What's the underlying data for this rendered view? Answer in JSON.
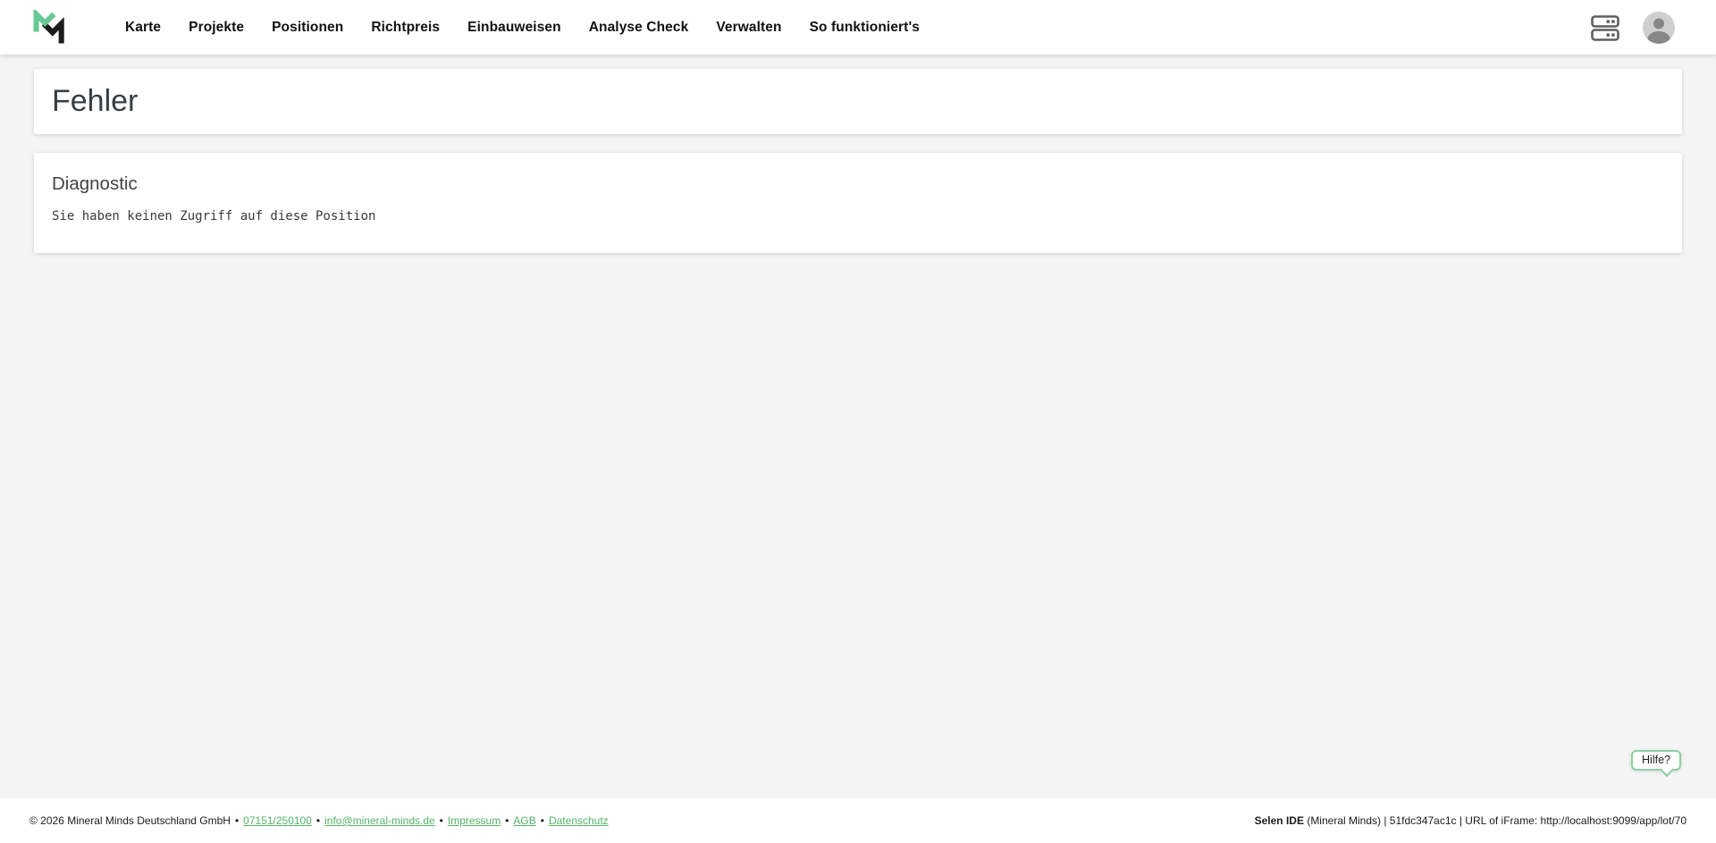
{
  "nav": {
    "items": [
      "Karte",
      "Projekte",
      "Positionen",
      "Richtpreis",
      "Einbauweisen",
      "Analyse Check",
      "Verwalten",
      "So funktioniert's"
    ],
    "icons": {
      "logo": "mineral-minds-logo",
      "storage": "storage-icon",
      "account": "account-avatar-icon"
    }
  },
  "page": {
    "title": "Fehler"
  },
  "diagnostic": {
    "heading": "Diagnostic",
    "message": "Sie haben keinen Zugriff auf diese Position"
  },
  "help": {
    "label": "Hilfe?"
  },
  "footer": {
    "copyright": "© 2026 Mineral Minds Deutschland GmbH",
    "separator": "•",
    "phone": "07151/250100",
    "email": "info@mineral-minds.de",
    "impressum": "Impressum",
    "agb": "AGB",
    "datenschutz": "Datenschutz",
    "app_name": "Selen IDE",
    "app_details": " (Mineral Minds) | 51fdc347ac1c | URL of iFrame: http://localhost:9099/app/lot/70"
  },
  "colors": {
    "brand_green": "#67C795",
    "link_green": "#55B169",
    "bubble_border_green": "#8BCFA4",
    "page_background": "#F4F4F4",
    "icon_gray": "#5F5F5F"
  }
}
